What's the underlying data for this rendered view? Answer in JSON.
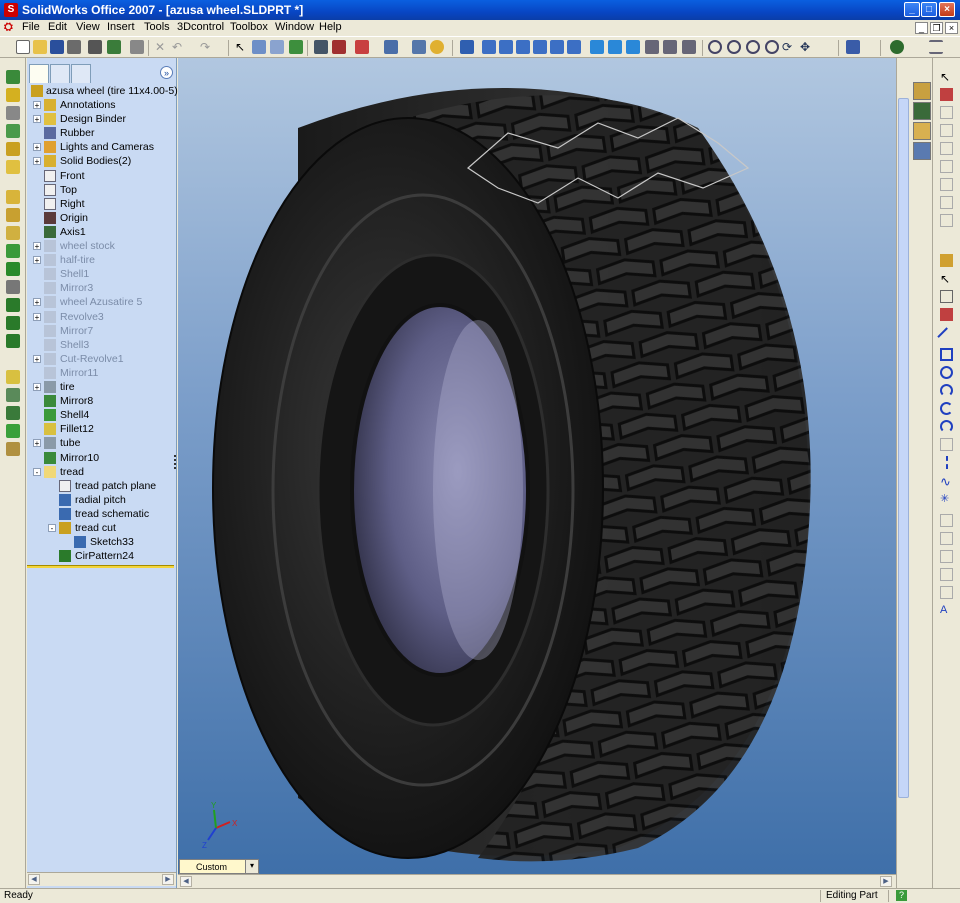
{
  "window": {
    "title": "SolidWorks Office 2007 - [azusa wheel.SLDPRT *]",
    "app_icon": "solidworks-logo-icon",
    "controls": [
      "minimize",
      "maximize",
      "close"
    ]
  },
  "menu": {
    "items": [
      "File",
      "Edit",
      "View",
      "Insert",
      "Tools",
      "3Dcontrol",
      "Toolbox",
      "Window",
      "Help"
    ]
  },
  "feature_manager": {
    "tabs": [
      "feature-manager-icon",
      "property-manager-icon",
      "configuration-manager-icon"
    ],
    "root": "azusa wheel  (tire 11x4.00-5)",
    "tree": [
      {
        "label": "Annotations",
        "icon": "annotations-icon",
        "expander": "+"
      },
      {
        "label": "Design Binder",
        "icon": "design-binder-icon",
        "expander": "+"
      },
      {
        "label": "Rubber",
        "icon": "material-icon",
        "expander": ""
      },
      {
        "label": "Lights and Cameras",
        "icon": "lights-icon",
        "expander": "+"
      },
      {
        "label": "Solid Bodies(2)",
        "icon": "solid-bodies-icon",
        "expander": "+"
      },
      {
        "label": "Front",
        "icon": "plane-icon",
        "expander": ""
      },
      {
        "label": "Top",
        "icon": "plane-icon",
        "expander": ""
      },
      {
        "label": "Right",
        "icon": "plane-icon",
        "expander": ""
      },
      {
        "label": "Origin",
        "icon": "origin-icon",
        "expander": ""
      },
      {
        "label": "Axis1",
        "icon": "axis-icon",
        "expander": ""
      },
      {
        "label": "wheel stock",
        "icon": "folder-icon",
        "expander": "+",
        "suppressed": true
      },
      {
        "label": "half-tire",
        "icon": "revolve-icon",
        "expander": "+",
        "suppressed": true
      },
      {
        "label": "Shell1",
        "icon": "shell-icon",
        "expander": "",
        "suppressed": true
      },
      {
        "label": "Mirror3",
        "icon": "mirror-icon",
        "expander": "",
        "suppressed": true
      },
      {
        "label": "wheel Azusatire 5",
        "icon": "folder-icon",
        "expander": "+",
        "suppressed": true
      },
      {
        "label": "Revolve3",
        "icon": "revolve-icon",
        "expander": "+",
        "suppressed": true
      },
      {
        "label": "Mirror7",
        "icon": "mirror-icon",
        "expander": "",
        "suppressed": true
      },
      {
        "label": "Shell3",
        "icon": "shell-icon",
        "expander": "",
        "suppressed": true
      },
      {
        "label": "Cut-Revolve1",
        "icon": "cut-revolve-icon",
        "expander": "+",
        "suppressed": true
      },
      {
        "label": "Mirror11",
        "icon": "mirror-icon",
        "expander": "",
        "suppressed": true
      },
      {
        "label": "tire",
        "icon": "revolve-icon",
        "expander": "+"
      },
      {
        "label": "Mirror8",
        "icon": "mirror-icon",
        "expander": ""
      },
      {
        "label": "Shell4",
        "icon": "shell-icon",
        "expander": ""
      },
      {
        "label": "Fillet12",
        "icon": "fillet-icon",
        "expander": ""
      },
      {
        "label": "tube",
        "icon": "revolve-icon",
        "expander": "+"
      },
      {
        "label": "Mirror10",
        "icon": "mirror-icon",
        "expander": ""
      },
      {
        "label": "tread",
        "icon": "folder-icon",
        "expander": "−"
      },
      {
        "label": "tread patch plane",
        "icon": "plane-icon",
        "expander": "",
        "indent": 1
      },
      {
        "label": "radial pitch",
        "icon": "sketch-icon",
        "expander": "",
        "indent": 1
      },
      {
        "label": "tread schematic",
        "icon": "sketch-icon",
        "expander": "",
        "indent": 1
      },
      {
        "label": "tread cut",
        "icon": "cut-extrude-icon",
        "expander": "−",
        "indent": 1
      },
      {
        "label": "Sketch33",
        "icon": "sketch-icon",
        "expander": "",
        "indent": 2
      },
      {
        "label": "CirPattern24",
        "icon": "circular-pattern-icon",
        "expander": "",
        "indent": 1
      }
    ]
  },
  "viewport": {
    "view_orientation": "Custom",
    "triad_labels": [
      "X",
      "Y",
      "Z"
    ],
    "model": "tire"
  },
  "status": {
    "left": "Ready",
    "mode": "Editing Part"
  },
  "colors": {
    "title_bar": "#0a4fd4",
    "feature_tree_bg": "#c9daf3",
    "viewport_top": "#b1c7e0",
    "viewport_bottom": "#3d6ea8",
    "rollback_bar": "#f3d53b"
  }
}
